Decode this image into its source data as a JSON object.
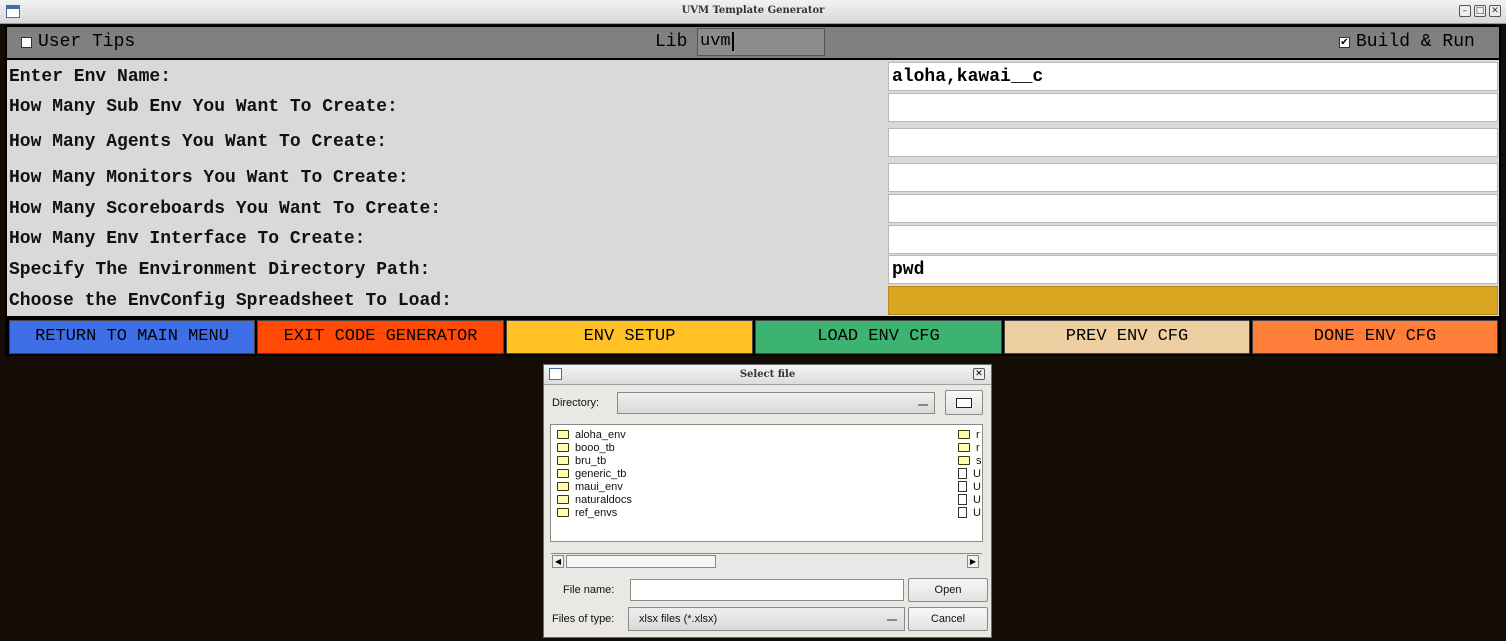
{
  "window": {
    "title": "UVM Template Generator",
    "min_glyph": "–",
    "max_glyph": "□",
    "close_glyph": "✕"
  },
  "topbar": {
    "user_tips_label": "User Tips",
    "user_tips_checked": false,
    "lib_label": "Lib",
    "lib_value": "uvm",
    "build_run_label": "Build & Run",
    "build_run_checked": true,
    "check_mark": "✔"
  },
  "form": {
    "rows": [
      {
        "label": "Enter Env Name:",
        "value": "aloha,kawai__c"
      },
      {
        "label": "How Many Sub Env You Want To Create:",
        "value": ""
      },
      {
        "label": "How Many Agents You Want To Create:",
        "value": ""
      },
      {
        "label": "How Many Monitors You Want To Create:",
        "value": ""
      },
      {
        "label": "How Many Scoreboards You Want To Create:",
        "value": ""
      },
      {
        "label": "How Many Env Interface To Create:",
        "value": ""
      },
      {
        "label": "Specify The Environment Directory Path:",
        "value": "pwd"
      },
      {
        "label": "Choose the EnvConfig Spreadsheet To Load:",
        "value": ""
      }
    ]
  },
  "buttons": [
    {
      "label": "RETURN TO MAIN MENU",
      "color": "#3f6fe6"
    },
    {
      "label": "EXIT CODE GENERATOR",
      "color": "#ff4a05"
    },
    {
      "label": "ENV SETUP",
      "color": "#ffc125"
    },
    {
      "label": "LOAD ENV CFG",
      "color": "#3cb371"
    },
    {
      "label": "PREV ENV CFG",
      "color": "#eecfa1"
    },
    {
      "label": "DONE ENV CFG",
      "color": "#ff7f3a"
    }
  ],
  "colors": {
    "spreadsheet_field": "#daa520",
    "background": "#140d06"
  },
  "dialog": {
    "title": "Select file",
    "directory_label": "Directory:",
    "directory_value": "",
    "files_left": [
      "aloha_env",
      "booo_tb",
      "bru_tb",
      "generic_tb",
      "maui_env",
      "naturaldocs",
      "ref_envs"
    ],
    "files_right": [
      {
        "name": "r",
        "type": "folder"
      },
      {
        "name": "r",
        "type": "folder"
      },
      {
        "name": "s",
        "type": "folder"
      },
      {
        "name": "U",
        "type": "file"
      },
      {
        "name": "U",
        "type": "file"
      },
      {
        "name": "U",
        "type": "file"
      },
      {
        "name": "U",
        "type": "file"
      }
    ],
    "file_name_label": "File name:",
    "file_name_value": "",
    "open_label": "Open",
    "files_of_type_label": "Files of type:",
    "files_of_type_value": "xlsx files (*.xlsx)",
    "cancel_label": "Cancel"
  }
}
